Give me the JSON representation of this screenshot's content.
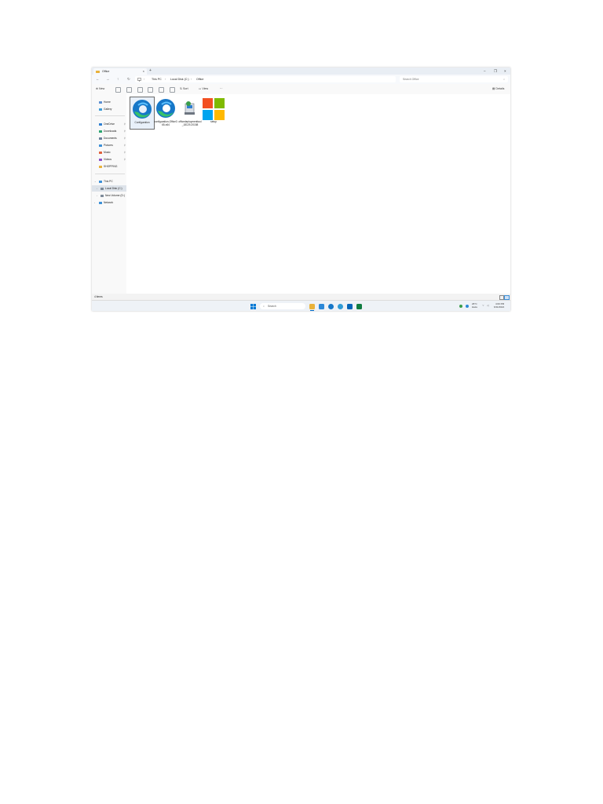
{
  "window": {
    "tab_title": "Office",
    "tab_close": "×",
    "new_tab": "+",
    "minimize": "–",
    "maximize": "❐",
    "close": "×"
  },
  "nav": {
    "back": "←",
    "forward": "→",
    "up": "↑",
    "refresh": "↻"
  },
  "breadcrumbs": [
    "This PC",
    "Local Disk (C:)",
    "Office"
  ],
  "search": {
    "placeholder": "Search Office"
  },
  "toolbar": {
    "new_label": "New",
    "sort_label": "Sort",
    "view_label": "View",
    "more_label": "···",
    "details_label": "Details"
  },
  "sidebar": {
    "home": "Home",
    "gallery": "Gallery",
    "quick_access": [
      "OneDrive",
      "Downloads",
      "Documents",
      "Pictures",
      "Music",
      "Videos",
      "SHOPPING"
    ],
    "this_pc": "This PC",
    "local_disk": "Local Disk (C:)",
    "new_volume": "New Volume (D:)",
    "network": "Network"
  },
  "files": [
    {
      "name": "Configuration",
      "icon": "edge-icon"
    },
    {
      "name": "configuration-Office365-x64",
      "icon": "edge-icon"
    },
    {
      "name": "officedeploymenttool_18129-20158",
      "icon": "installer-icon"
    },
    {
      "name": "setup",
      "icon": "microsoft-logo-icon"
    }
  ],
  "status": {
    "items": "4 items"
  },
  "taskbar": {
    "search_placeholder": "Search",
    "weather_temp": "26°C",
    "weather_desc": "Haze",
    "time": "4:00 PM",
    "date": "6/11/2024"
  },
  "colors": {
    "accent": "#0067c0",
    "folder": "#e9b23a",
    "edge_blue": "#1677c8",
    "edge_green": "#37c26a"
  }
}
